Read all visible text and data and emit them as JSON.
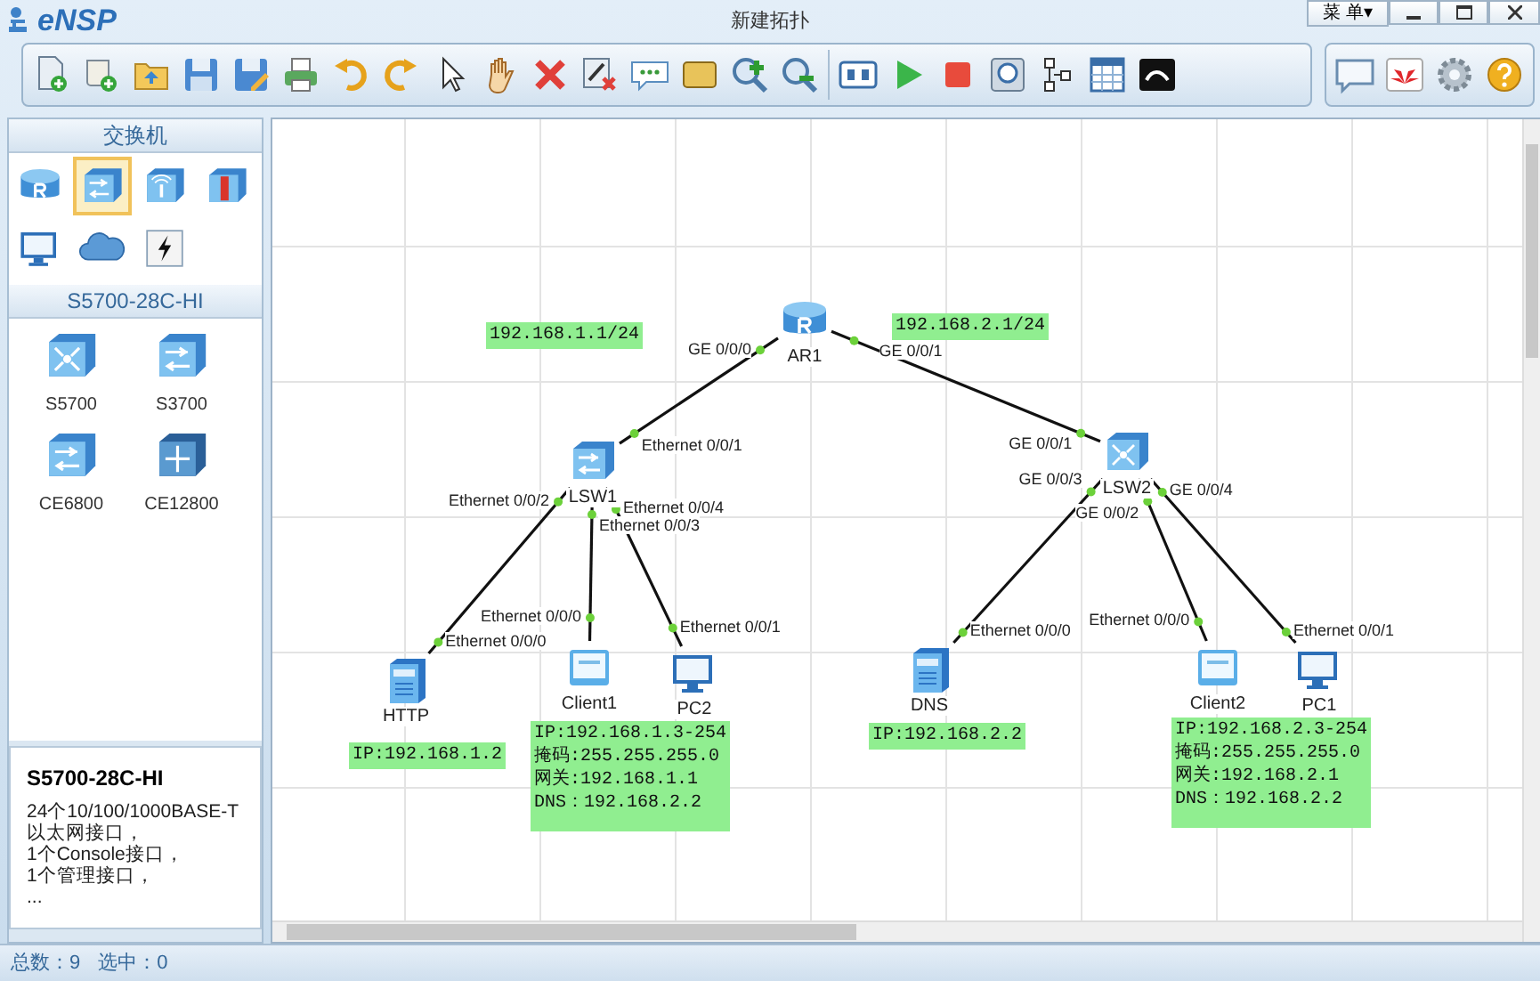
{
  "window": {
    "logo_text": "eNSP",
    "title": "新建拓扑",
    "menu_button": "菜 单▾"
  },
  "palette": {
    "header": "交换机",
    "categories": [
      {
        "kind": "router",
        "selected": false
      },
      {
        "kind": "switch",
        "selected": true
      },
      {
        "kind": "wireless",
        "selected": false
      },
      {
        "kind": "firewall",
        "selected": false
      },
      {
        "kind": "pc",
        "selected": false
      },
      {
        "kind": "cloud",
        "selected": false
      },
      {
        "kind": "power",
        "selected": false
      }
    ],
    "model_header": "S5700-28C-HI",
    "models": [
      {
        "label": "S5700",
        "kind": "core-switch"
      },
      {
        "label": "S3700",
        "kind": "switch"
      },
      {
        "label": "CE6800",
        "kind": "switch"
      },
      {
        "label": "CE12800",
        "kind": "dc-switch"
      }
    ],
    "description": {
      "title": "S5700-28C-HI",
      "lines": [
        "24个10/100/1000BASE-T以太网接口，",
        "1个Console接口，",
        "1个管理接口，",
        "..."
      ]
    }
  },
  "topology": {
    "nodes": [
      {
        "label": "AR1",
        "kind": "router"
      },
      {
        "label": "LSW1",
        "kind": "switch"
      },
      {
        "label": "LSW2",
        "kind": "core-switch"
      },
      {
        "label": "HTTP",
        "kind": "server"
      },
      {
        "label": "Client1",
        "kind": "client"
      },
      {
        "label": "PC2",
        "kind": "pc"
      },
      {
        "label": "DNS",
        "kind": "server"
      },
      {
        "label": "Client2",
        "kind": "client"
      },
      {
        "label": "PC1",
        "kind": "pc"
      }
    ],
    "links": [
      {
        "ports": [
          "GE 0/0/0",
          "Ethernet 0/0/1"
        ]
      },
      {
        "ports": [
          "GE 0/0/1",
          "GE 0/0/1"
        ]
      },
      {
        "ports": [
          "Ethernet 0/0/2",
          "Ethernet 0/0/0"
        ]
      },
      {
        "ports": [
          "Ethernet 0/0/3",
          "Ethernet 0/0/0"
        ]
      },
      {
        "ports": [
          "Ethernet 0/0/4",
          "Ethernet 0/0/1"
        ]
      },
      {
        "ports": [
          "GE 0/0/3",
          "Ethernet 0/0/0"
        ]
      },
      {
        "ports": [
          "GE 0/0/2",
          "Ethernet 0/0/0"
        ]
      },
      {
        "ports": [
          "GE 0/0/4",
          "Ethernet 0/0/1"
        ]
      }
    ],
    "notes": [
      {
        "lines": [
          "192.168.1.1/24"
        ]
      },
      {
        "lines": [
          "192.168.2.1/24"
        ]
      },
      {
        "lines": [
          "IP:192.168.1.2"
        ]
      },
      {
        "lines": [
          "IP:192.168.1.3-254",
          "掩码:255.255.255.0",
          "网关:192.168.1.1",
          "DNS：192.168.2.2"
        ]
      },
      {
        "lines": [
          "IP:192.168.2.2"
        ]
      },
      {
        "lines": [
          "IP:192.168.2.3-254",
          "掩码:255.255.255.0",
          "网关:192.168.2.1",
          "DNS：192.168.2.2"
        ]
      }
    ]
  },
  "status_bar": {
    "total": "总数：9",
    "selected": "选中：0"
  }
}
